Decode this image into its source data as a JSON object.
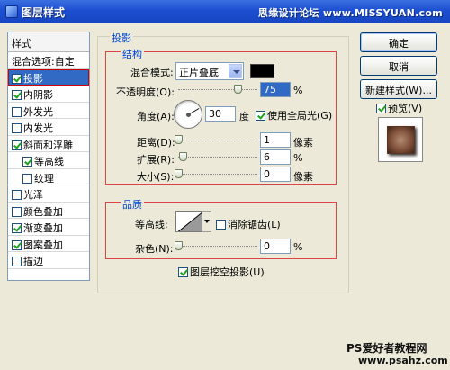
{
  "window": {
    "title": "图层样式",
    "watermark": "思缘设计论坛 www.MISSYUAN.com"
  },
  "style_list": {
    "header": "样式",
    "items": [
      {
        "label": "混合选项:自定",
        "checkbox": false,
        "checked": false,
        "selected": false,
        "indent": false
      },
      {
        "label": "投影",
        "checkbox": true,
        "checked": true,
        "selected": true,
        "indent": false
      },
      {
        "label": "内阴影",
        "checkbox": true,
        "checked": true,
        "selected": false,
        "indent": false
      },
      {
        "label": "外发光",
        "checkbox": true,
        "checked": false,
        "selected": false,
        "indent": false
      },
      {
        "label": "内发光",
        "checkbox": true,
        "checked": false,
        "selected": false,
        "indent": false
      },
      {
        "label": "斜面和浮雕",
        "checkbox": true,
        "checked": true,
        "selected": false,
        "indent": false
      },
      {
        "label": "等高线",
        "checkbox": true,
        "checked": true,
        "selected": false,
        "indent": true
      },
      {
        "label": "纹理",
        "checkbox": true,
        "checked": false,
        "selected": false,
        "indent": true
      },
      {
        "label": "光泽",
        "checkbox": true,
        "checked": false,
        "selected": false,
        "indent": false
      },
      {
        "label": "颜色叠加",
        "checkbox": true,
        "checked": false,
        "selected": false,
        "indent": false
      },
      {
        "label": "渐变叠加",
        "checkbox": true,
        "checked": true,
        "selected": false,
        "indent": false
      },
      {
        "label": "图案叠加",
        "checkbox": true,
        "checked": true,
        "selected": false,
        "indent": false
      },
      {
        "label": "描边",
        "checkbox": true,
        "checked": false,
        "selected": false,
        "indent": false
      }
    ]
  },
  "drop_shadow": {
    "group_title": "投影",
    "structure": {
      "title": "结构",
      "blend_mode_label": "混合模式:",
      "blend_mode_value": "正片叠底",
      "color": "#000000",
      "opacity_label": "不透明度(O):",
      "opacity_value": "75",
      "opacity_unit": "%",
      "opacity_level": 0.75,
      "angle_label": "角度(A):",
      "angle_value": "30",
      "angle_unit": "度",
      "global_light_label": "使用全局光(G)",
      "global_light_checked": true,
      "distance_label": "距离(D):",
      "distance_value": "1",
      "distance_unit": "像素",
      "distance_level": 0.0,
      "spread_label": "扩展(R):",
      "spread_value": "6",
      "spread_unit": "%",
      "spread_level": 0.06,
      "size_label": "大小(S):",
      "size_value": "0",
      "size_unit": "像素",
      "size_level": 0.0
    },
    "quality": {
      "title": "品质",
      "contour_label": "等高线:",
      "antialias_label": "消除锯齿(L)",
      "antialias_checked": false,
      "noise_label": "杂色(N):",
      "noise_value": "0",
      "noise_unit": "%",
      "noise_level": 0.0
    },
    "knockout_label": "图层挖空投影(U)",
    "knockout_checked": true
  },
  "buttons": {
    "ok": "确定",
    "cancel": "取消",
    "new_style": "新建样式(W)...",
    "preview_label": "预览(V)",
    "preview_checked": true
  },
  "footer_watermark": {
    "line1": "PS爱好者教程网",
    "line2": "www.psahz.com"
  }
}
